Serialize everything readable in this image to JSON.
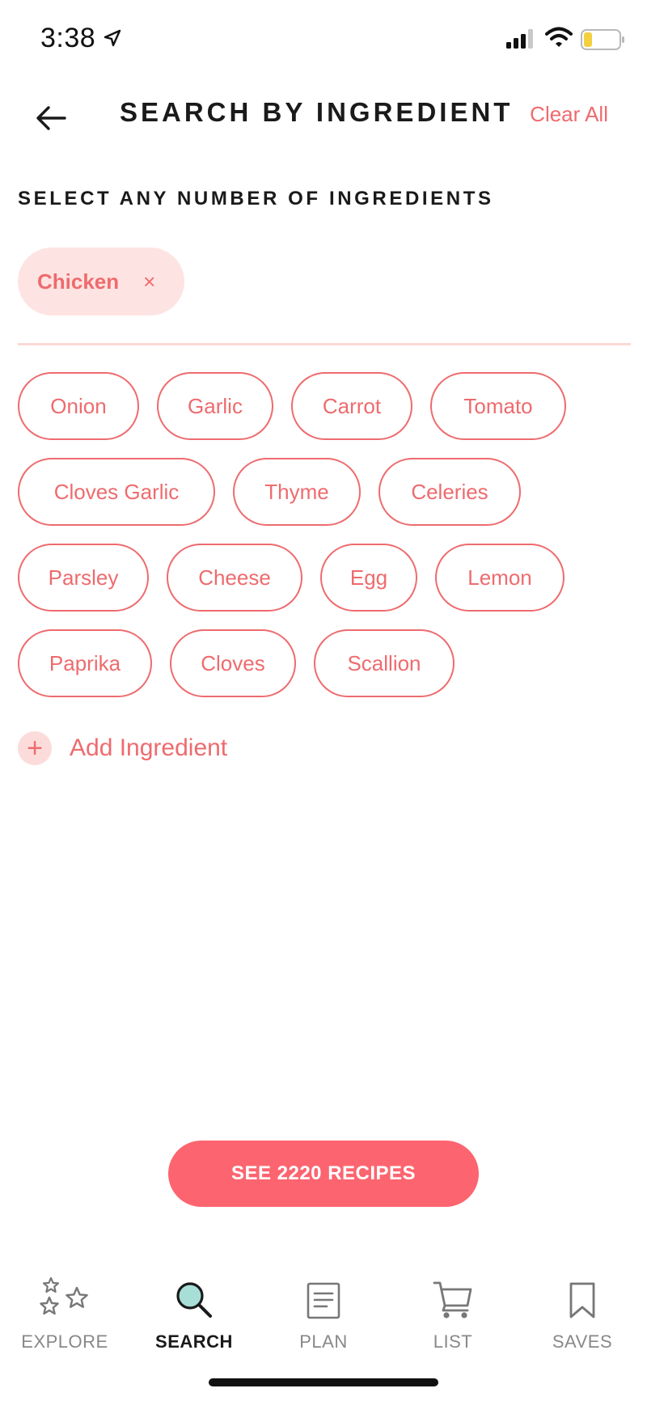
{
  "status_bar": {
    "time": "3:38"
  },
  "header": {
    "title": "SEARCH BY INGREDIENT",
    "clear_all": "Clear All"
  },
  "section_label": "SELECT ANY NUMBER OF INGREDIENTS",
  "selected": [
    {
      "label": "Chicken",
      "remove_glyph": "×"
    }
  ],
  "suggestions": {
    "rows": [
      [
        "Onion",
        "Garlic",
        "Carrot",
        "Tomato"
      ],
      [
        "Cloves Garlic",
        "Thyme",
        "Celeries"
      ],
      [
        "Parsley",
        "Cheese",
        "Egg",
        "Lemon"
      ],
      [
        "Paprika",
        "Cloves",
        "Scallion"
      ]
    ]
  },
  "add_ingredient": {
    "label": "Add Ingredient",
    "icon": "plus-icon"
  },
  "cta": {
    "label": "SEE 2220 RECIPES"
  },
  "tabs": [
    {
      "label": "EXPLORE",
      "icon": "stars-icon",
      "active": false
    },
    {
      "label": "SEARCH",
      "icon": "magnifier-icon",
      "active": true
    },
    {
      "label": "PLAN",
      "icon": "document-icon",
      "active": false
    },
    {
      "label": "LIST",
      "icon": "cart-icon",
      "active": false
    },
    {
      "label": "SAVES",
      "icon": "bookmark-icon",
      "active": false
    }
  ],
  "colors": {
    "accent": "#ee6b6e",
    "button": "#fc6570",
    "chip_selected_bg": "#fde4e2",
    "divider": "#fcd8d4"
  }
}
